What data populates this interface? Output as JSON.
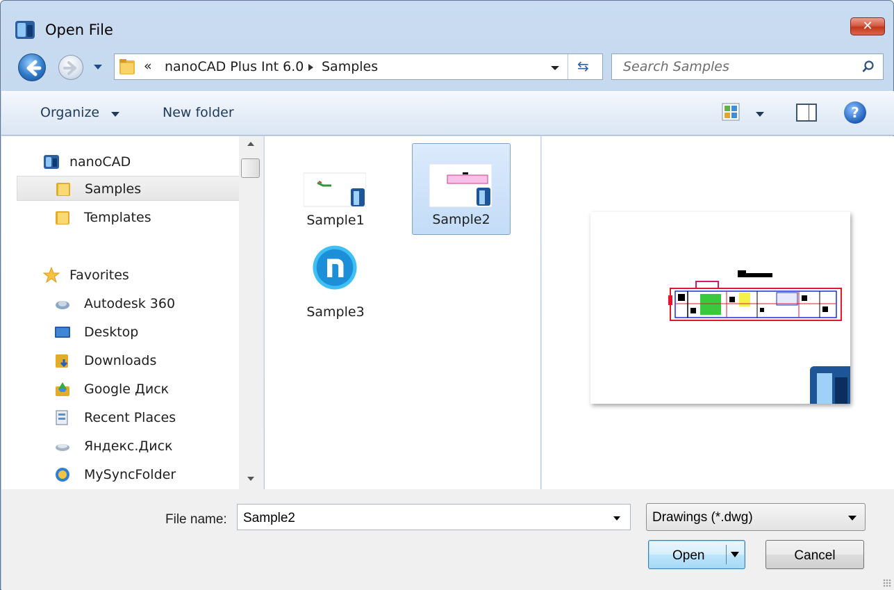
{
  "window": {
    "title": "Open File",
    "close_glyph": "✕"
  },
  "navigation": {
    "address_overflow": "«",
    "breadcrumb": [
      "nanoCAD Plus Int 6.0",
      "Samples"
    ],
    "refresh_glyph": "⇆",
    "search_placeholder": "Search Samples"
  },
  "toolbar": {
    "organize_label": "Organize",
    "new_folder_label": "New folder",
    "help_glyph": "?"
  },
  "nav_pane": {
    "items": [
      {
        "label": "nanoCAD",
        "icon": "nanocad-icon"
      },
      {
        "label": "Samples",
        "icon": "folder-icon",
        "selected": true
      },
      {
        "label": "Templates",
        "icon": "folder-icon"
      },
      {
        "label": "Favorites",
        "icon": "star-icon"
      },
      {
        "label": "Autodesk 360",
        "icon": "cloud-icon"
      },
      {
        "label": "Desktop",
        "icon": "desktop-icon"
      },
      {
        "label": "Downloads",
        "icon": "downloads-icon"
      },
      {
        "label": "Google Диск",
        "icon": "google-drive-icon"
      },
      {
        "label": "Recent Places",
        "icon": "recent-places-icon"
      },
      {
        "label": "Яндекс.Диск",
        "icon": "yandex-disk-icon"
      },
      {
        "label": "MySyncFolder",
        "icon": "sync-folder-icon"
      }
    ]
  },
  "files": [
    {
      "name": "Sample1",
      "selected": false
    },
    {
      "name": "Sample2",
      "selected": true
    },
    {
      "name": "Sample3",
      "selected": false
    }
  ],
  "bottom": {
    "file_name_label": "File name:",
    "file_name_value": "Sample2",
    "file_type_value": "Drawings (*.dwg)",
    "open_label": "Open",
    "cancel_label": "Cancel"
  },
  "colors": {
    "selection": "#c3dcf7",
    "frame": "#b9cfe9",
    "accent": "#3c7fb1"
  }
}
